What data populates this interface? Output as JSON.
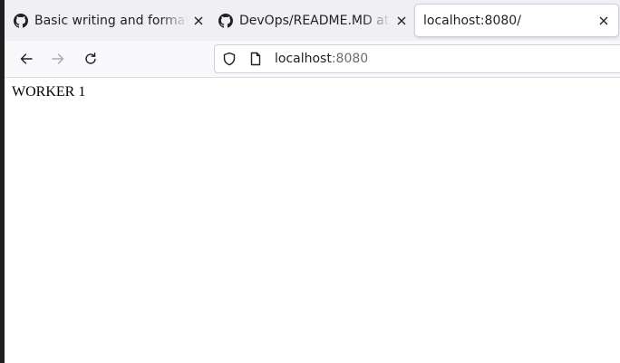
{
  "browser": {
    "tabs": [
      {
        "title": "Basic writing and formatting syntax",
        "icon": "github-icon",
        "active": false
      },
      {
        "title": "DevOps/README.MD at main",
        "icon": "github-icon",
        "active": false
      },
      {
        "title": "localhost:8080/",
        "icon": "",
        "active": true
      }
    ],
    "toolbar": {
      "back_icon": "arrow-left-icon",
      "forward_icon": "arrow-right-icon",
      "reload_icon": "reload-icon"
    },
    "urlbar": {
      "host": "localhost",
      "port": ":8080",
      "shield_icon": "shield-icon",
      "page_icon": "page-icon"
    }
  },
  "page": {
    "text": "WORKER 1"
  },
  "colors": {
    "tabbar_bg": "#f0f0f4",
    "toolbar_bg": "#f9f9fb",
    "active_tab_bg": "#ffffff",
    "text": "#1f1f26"
  }
}
